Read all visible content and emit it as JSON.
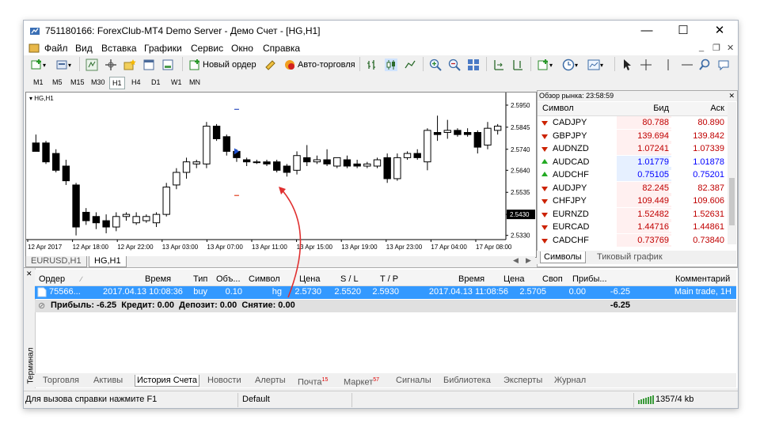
{
  "window": {
    "title": "751180166: ForexClub-MT4 Demo Server - Демо Счет - [HG,H1]"
  },
  "menu": [
    "Файл",
    "Вид",
    "Вставка",
    "Графики",
    "Сервис",
    "Окно",
    "Справка"
  ],
  "toolbar": {
    "new_order": "Новый ордер",
    "auto_trading": "Авто-торговля"
  },
  "timeframes": [
    "M1",
    "M5",
    "M15",
    "M30",
    "H1",
    "H4",
    "D1",
    "W1",
    "MN"
  ],
  "timeframe_active": "H1",
  "chart": {
    "symbol_label": "HG,H1",
    "current_price": "2.5430",
    "price_ticks": [
      "2.5950",
      "2.5845",
      "2.5740",
      "2.5640",
      "2.5535",
      "2.5430",
      "2.5330"
    ],
    "time_ticks": [
      "12 Apr 2017",
      "12 Apr 18:00",
      "12 Apr 22:00",
      "13 Apr 03:00",
      "13 Apr 07:00",
      "13 Apr 11:00",
      "13 Apr 15:00",
      "13 Apr 19:00",
      "13 Apr 23:00",
      "17 Apr 04:00",
      "17 Apr 08:00"
    ],
    "tabs": [
      "EURUSD,H1",
      "HG,H1"
    ],
    "active_tab": "HG,H1",
    "candles": [
      {
        "o": 2.577,
        "h": 2.581,
        "l": 2.573,
        "c": 2.573
      },
      {
        "o": 2.577,
        "h": 2.578,
        "l": 2.567,
        "c": 2.568
      },
      {
        "o": 2.572,
        "h": 2.574,
        "l": 2.563,
        "c": 2.564
      },
      {
        "o": 2.566,
        "h": 2.569,
        "l": 2.557,
        "c": 2.559
      },
      {
        "o": 2.557,
        "h": 2.558,
        "l": 2.533,
        "c": 2.537
      },
      {
        "o": 2.544,
        "h": 2.546,
        "l": 2.538,
        "c": 2.54
      },
      {
        "o": 2.542,
        "h": 2.544,
        "l": 2.536,
        "c": 2.539
      },
      {
        "o": 2.54,
        "h": 2.543,
        "l": 2.534,
        "c": 2.537
      },
      {
        "o": 2.537,
        "h": 2.544,
        "l": 2.535,
        "c": 2.542
      },
      {
        "o": 2.542,
        "h": 2.544,
        "l": 2.54,
        "c": 2.543
      },
      {
        "o": 2.539,
        "h": 2.544,
        "l": 2.538,
        "c": 2.542
      },
      {
        "o": 2.54,
        "h": 2.543,
        "l": 2.539,
        "c": 2.542
      },
      {
        "o": 2.539,
        "h": 2.544,
        "l": 2.537,
        "c": 2.543
      },
      {
        "o": 2.543,
        "h": 2.558,
        "l": 2.542,
        "c": 2.556
      },
      {
        "o": 2.557,
        "h": 2.565,
        "l": 2.555,
        "c": 2.563
      },
      {
        "o": 2.563,
        "h": 2.57,
        "l": 2.56,
        "c": 2.568
      },
      {
        "o": 2.567,
        "h": 2.569,
        "l": 2.565,
        "c": 2.568
      },
      {
        "o": 2.567,
        "h": 2.587,
        "l": 2.565,
        "c": 2.585
      },
      {
        "o": 2.585,
        "h": 2.586,
        "l": 2.578,
        "c": 2.579
      },
      {
        "o": 2.58,
        "h": 2.581,
        "l": 2.571,
        "c": 2.573
      },
      {
        "o": 2.573,
        "h": 2.574,
        "l": 2.568,
        "c": 2.57
      },
      {
        "o": 2.569,
        "h": 2.57,
        "l": 2.566,
        "c": 2.568
      },
      {
        "o": 2.568,
        "h": 2.569,
        "l": 2.567,
        "c": 2.568
      },
      {
        "o": 2.568,
        "h": 2.569,
        "l": 2.566,
        "c": 2.567
      },
      {
        "o": 2.568,
        "h": 2.569,
        "l": 2.563,
        "c": 2.564
      },
      {
        "o": 2.566,
        "h": 2.567,
        "l": 2.561,
        "c": 2.563
      },
      {
        "o": 2.564,
        "h": 2.573,
        "l": 2.562,
        "c": 2.571
      },
      {
        "o": 2.57,
        "h": 2.576,
        "l": 2.566,
        "c": 2.568
      },
      {
        "o": 2.568,
        "h": 2.571,
        "l": 2.567,
        "c": 2.569
      },
      {
        "o": 2.569,
        "h": 2.574,
        "l": 2.566,
        "c": 2.567
      },
      {
        "o": 2.566,
        "h": 2.57,
        "l": 2.565,
        "c": 2.57
      },
      {
        "o": 2.569,
        "h": 2.571,
        "l": 2.565,
        "c": 2.566
      },
      {
        "o": 2.567,
        "h": 2.569,
        "l": 2.565,
        "c": 2.566
      },
      {
        "o": 2.566,
        "h": 2.568,
        "l": 2.565,
        "c": 2.567
      },
      {
        "o": 2.566,
        "h": 2.57,
        "l": 2.565,
        "c": 2.569
      },
      {
        "o": 2.57,
        "h": 2.572,
        "l": 2.558,
        "c": 2.56
      },
      {
        "o": 2.56,
        "h": 2.572,
        "l": 2.559,
        "c": 2.57
      },
      {
        "o": 2.57,
        "h": 2.573,
        "l": 2.569,
        "c": 2.572
      },
      {
        "o": 2.572,
        "h": 2.574,
        "l": 2.569,
        "c": 2.57
      },
      {
        "o": 2.568,
        "h": 2.584,
        "l": 2.564,
        "c": 2.583
      },
      {
        "o": 2.582,
        "h": 2.59,
        "l": 2.578,
        "c": 2.581
      },
      {
        "o": 2.582,
        "h": 2.588,
        "l": 2.579,
        "c": 2.583
      },
      {
        "o": 2.583,
        "h": 2.584,
        "l": 2.58,
        "c": 2.581
      },
      {
        "o": 2.582,
        "h": 2.584,
        "l": 2.58,
        "c": 2.581
      },
      {
        "o": 2.582,
        "h": 2.583,
        "l": 2.572,
        "c": 2.575
      },
      {
        "o": 2.576,
        "h": 2.587,
        "l": 2.574,
        "c": 2.584
      },
      {
        "o": 2.583,
        "h": 2.586,
        "l": 2.581,
        "c": 2.585
      }
    ]
  },
  "market_watch": {
    "title": "Обзор рынка: 23:58:59",
    "columns": [
      "Символ",
      "Бид",
      "Аск"
    ],
    "rows": [
      {
        "symbol": "CADJPY",
        "bid": "80.788",
        "ask": "80.890",
        "dir": "down"
      },
      {
        "symbol": "GBPJPY",
        "bid": "139.694",
        "ask": "139.842",
        "dir": "down"
      },
      {
        "symbol": "AUDNZD",
        "bid": "1.07241",
        "ask": "1.07339",
        "dir": "down"
      },
      {
        "symbol": "AUDCAD",
        "bid": "1.01779",
        "ask": "1.01878",
        "dir": "up"
      },
      {
        "symbol": "AUDCHF",
        "bid": "0.75105",
        "ask": "0.75201",
        "dir": "up"
      },
      {
        "symbol": "AUDJPY",
        "bid": "82.245",
        "ask": "82.387",
        "dir": "down"
      },
      {
        "symbol": "CHFJPY",
        "bid": "109.449",
        "ask": "109.606",
        "dir": "down"
      },
      {
        "symbol": "EURNZD",
        "bid": "1.52482",
        "ask": "1.52631",
        "dir": "down"
      },
      {
        "symbol": "EURCAD",
        "bid": "1.44716",
        "ask": "1.44861",
        "dir": "down"
      },
      {
        "symbol": "CADCHF",
        "bid": "0.73769",
        "ask": "0.73840",
        "dir": "down"
      }
    ],
    "tabs": [
      "Символы",
      "Тиковый график"
    ],
    "active_tab": "Символы"
  },
  "terminal": {
    "label": "Терминал",
    "columns": [
      "Ордер",
      "Время",
      "Тип",
      "Объ...",
      "Символ",
      "Цена",
      "S / L",
      "T / P",
      "Время",
      "Цена",
      "Своп",
      "Прибы...",
      "Комментарий"
    ],
    "order": {
      "id": "75566...",
      "open_time": "2017.04.13 10:08:36",
      "type": "buy",
      "volume": "0.10",
      "symbol": "hg",
      "open_price": "2.5730",
      "sl": "2.5520",
      "tp": "2.5930",
      "close_time": "2017.04.13 11:08:56",
      "close_price": "2.5705",
      "swap": "0.00",
      "profit": "-6.25",
      "comment": "Main trade, 1H"
    },
    "summary": "Прибыль: -6.25  Кредит: 0.00  Депозит: 0.00  Снятие: 0.00",
    "summary_profit": "-6.25",
    "tabs": [
      {
        "label": "Торговля"
      },
      {
        "label": "Активы"
      },
      {
        "label": "История Счета"
      },
      {
        "label": "Новости"
      },
      {
        "label": "Алерты"
      },
      {
        "label": "Почта",
        "badge": "15"
      },
      {
        "label": "Маркет",
        "badge": "57"
      },
      {
        "label": "Сигналы"
      },
      {
        "label": "Библиотека"
      },
      {
        "label": "Эксперты"
      },
      {
        "label": "Журнал"
      }
    ],
    "active_tab": "История Счета"
  },
  "statusbar": {
    "help": "Для вызова справки нажмите F1",
    "profile": "Default",
    "traffic": "1357/4 kb"
  },
  "colors": {
    "selected_row": "#3399ff",
    "bid": "#c00000",
    "bid_up": "#0000ff",
    "arrow_up": "#22aa22",
    "arrow_down": "#cc2200",
    "current_price_bg": "#000000",
    "annotation_arrow": "#e03030"
  }
}
